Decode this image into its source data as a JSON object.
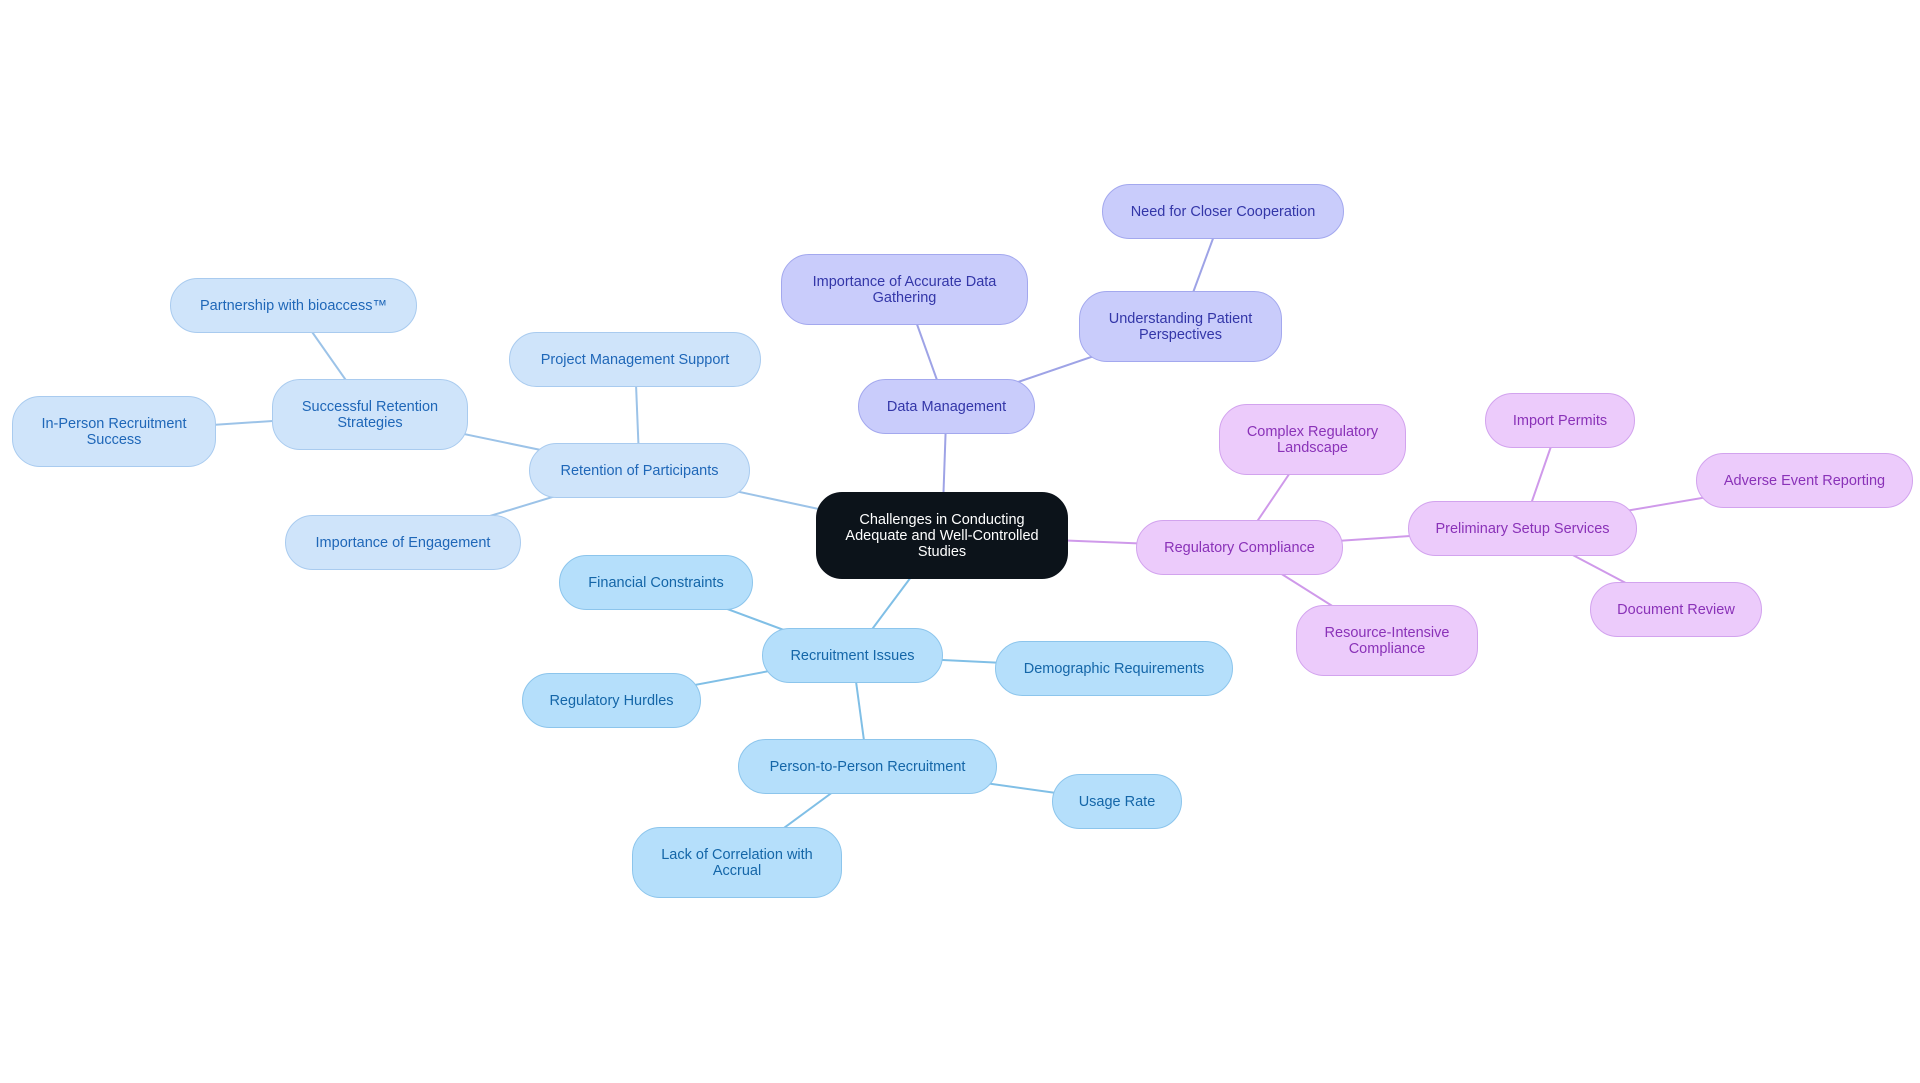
{
  "root": {
    "id": "root",
    "label": "Challenges in Conducting\nAdequate and Well-Controlled\nStudies"
  },
  "branch_colors": {
    "retention": {
      "fill": "#cfe4fa",
      "stroke": "#a9cbef",
      "text": "#1f67b8",
      "line": "#9cc3e8"
    },
    "recruitment": {
      "fill": "#b5dffb",
      "stroke": "#8cc5ec",
      "text": "#1466a8",
      "line": "#80bfe6"
    },
    "data": {
      "fill": "#c9ccfb",
      "stroke": "#a3a8ee",
      "text": "#3336a8",
      "line": "#9ea3e6"
    },
    "regulatory": {
      "fill": "#eccbfb",
      "stroke": "#d2a3ee",
      "text": "#8a32b8",
      "line": "#cf99ea"
    }
  },
  "nodes": [
    {
      "id": "retention",
      "label": "Retention of Participants",
      "parent": "root",
      "branch": "retention"
    },
    {
      "id": "successful-retention",
      "label": "Successful Retention\nStrategies",
      "parent": "retention",
      "branch": "retention"
    },
    {
      "id": "partnership",
      "label": "Partnership with bioaccess™",
      "parent": "successful-retention",
      "branch": "retention"
    },
    {
      "id": "in-person",
      "label": "In-Person Recruitment\nSuccess",
      "parent": "successful-retention",
      "branch": "retention"
    },
    {
      "id": "project-mgmt",
      "label": "Project Management Support",
      "parent": "retention",
      "branch": "retention"
    },
    {
      "id": "engagement",
      "label": "Importance of Engagement",
      "parent": "retention",
      "branch": "retention"
    },
    {
      "id": "recruitment",
      "label": "Recruitment Issues",
      "parent": "root",
      "branch": "recruitment"
    },
    {
      "id": "financial",
      "label": "Financial Constraints",
      "parent": "recruitment",
      "branch": "recruitment"
    },
    {
      "id": "reg-hurdles",
      "label": "Regulatory Hurdles",
      "parent": "recruitment",
      "branch": "recruitment"
    },
    {
      "id": "demographic",
      "label": "Demographic Requirements",
      "parent": "recruitment",
      "branch": "recruitment"
    },
    {
      "id": "p2p",
      "label": "Person-to-Person Recruitment",
      "parent": "recruitment",
      "branch": "recruitment"
    },
    {
      "id": "usage-rate",
      "label": "Usage Rate",
      "parent": "p2p",
      "branch": "recruitment"
    },
    {
      "id": "lack-correlation",
      "label": "Lack of Correlation with\nAccrual",
      "parent": "p2p",
      "branch": "recruitment"
    },
    {
      "id": "data-mgmt",
      "label": "Data Management",
      "parent": "root",
      "branch": "data"
    },
    {
      "id": "accurate-data",
      "label": "Importance of Accurate Data\nGathering",
      "parent": "data-mgmt",
      "branch": "data"
    },
    {
      "id": "patient-persp",
      "label": "Understanding Patient\nPerspectives",
      "parent": "data-mgmt",
      "branch": "data"
    },
    {
      "id": "cooperation",
      "label": "Need for Closer Cooperation",
      "parent": "patient-persp",
      "branch": "data"
    },
    {
      "id": "reg-compliance",
      "label": "Regulatory Compliance",
      "parent": "root",
      "branch": "regulatory"
    },
    {
      "id": "complex-reg",
      "label": "Complex Regulatory\nLandscape",
      "parent": "reg-compliance",
      "branch": "regulatory"
    },
    {
      "id": "resource-intensive",
      "label": "Resource-Intensive\nCompliance",
      "parent": "reg-compliance",
      "branch": "regulatory"
    },
    {
      "id": "prelim-setup",
      "label": "Preliminary Setup Services",
      "parent": "reg-compliance",
      "branch": "regulatory"
    },
    {
      "id": "import-permits",
      "label": "Import Permits",
      "parent": "prelim-setup",
      "branch": "regulatory"
    },
    {
      "id": "adverse-event",
      "label": "Adverse Event Reporting",
      "parent": "prelim-setup",
      "branch": "regulatory"
    },
    {
      "id": "doc-review",
      "label": "Document Review",
      "parent": "prelim-setup",
      "branch": "regulatory"
    }
  ]
}
